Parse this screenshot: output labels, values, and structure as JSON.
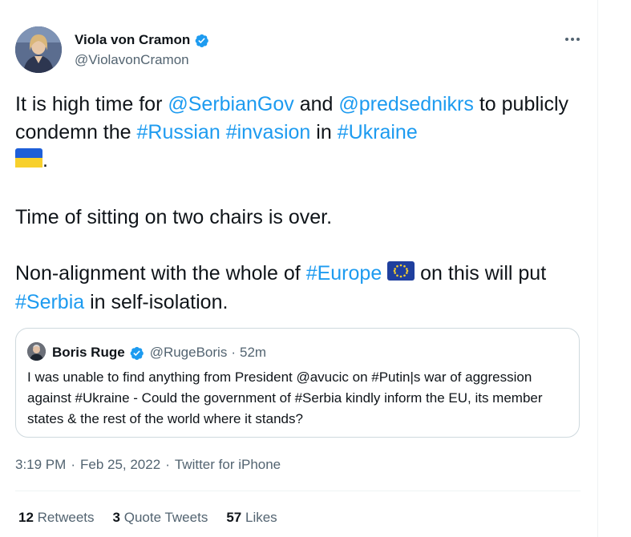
{
  "author": {
    "name": "Viola von Cramon",
    "handle": "@ViolavonCramon",
    "verified": true
  },
  "more_icon": "more-horizontal-icon",
  "tweet": {
    "p1": {
      "t1": "It is high time for ",
      "m1": "@SerbianGov",
      "t2": " and ",
      "m2": "@predsednikrs",
      "t3": " to publicly condemn the ",
      "h1": "#Russian",
      "t4": " ",
      "h2": "#invasion",
      "t5": " in ",
      "h3": "#Ukraine",
      "t6": "."
    },
    "p2": "Time of sitting on two chairs is over.",
    "p3": {
      "t1": "Non-alignment with the whole of ",
      "h1": "#Europe",
      "t2": " on this will put ",
      "h2": "#Serbia",
      "t3": " in self-isolation."
    }
  },
  "quote": {
    "name": "Boris Ruge",
    "handle": "@RugeBoris",
    "sep": "·",
    "time": "52m",
    "text": "I was unable to find anything from President @avucic on #Putin|s war of aggression against #Ukraine - Could the government of #Serbia kindly inform the EU, its member states & the rest of the world where it stands?"
  },
  "meta": {
    "time": "3:19 PM",
    "dot1": "·",
    "date": "Feb 25, 2022",
    "dot2": "·",
    "source": "Twitter for iPhone"
  },
  "stats": [
    {
      "count": "12",
      "label": "Retweets"
    },
    {
      "count": "3",
      "label": "Quote Tweets"
    },
    {
      "count": "57",
      "label": "Likes"
    }
  ],
  "colors": {
    "link": "#1d9bf0",
    "text": "#0f1419",
    "secondary": "#536471",
    "border": "#cfd9de"
  }
}
